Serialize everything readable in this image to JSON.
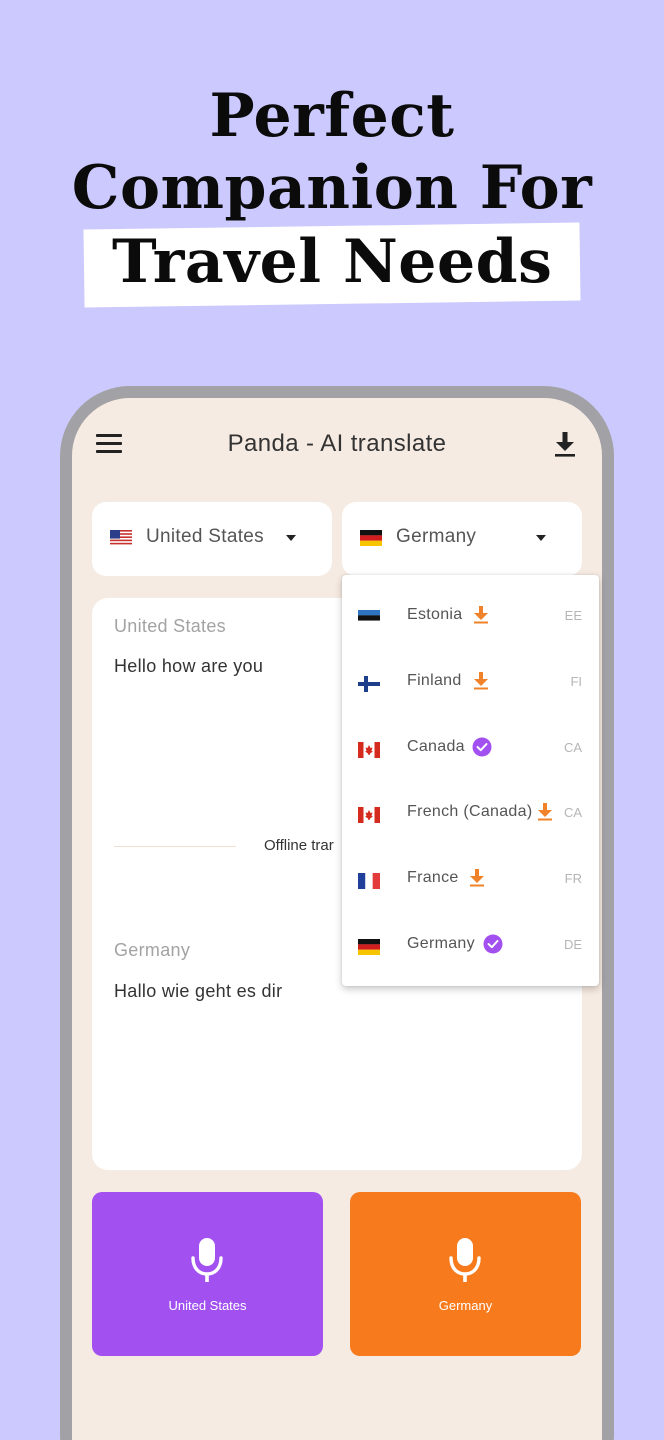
{
  "headline": {
    "line1": "Perfect",
    "line2": "Companion For",
    "line3": "Travel Needs"
  },
  "app": {
    "title": "Panda - AI translate",
    "menu_icon": "hamburger-menu-icon",
    "download_icon": "download-icon"
  },
  "selectors": {
    "source": {
      "label": "United States",
      "flag": "us"
    },
    "target": {
      "label": "Germany",
      "flag": "de"
    }
  },
  "translation": {
    "source_label": "United States",
    "source_text": "Hello how are you",
    "offline_text": "Offline trar",
    "target_label": "Germany",
    "target_text": "Hallo wie geht es dir"
  },
  "mic_buttons": {
    "left": {
      "label": "United States",
      "color": "#a251f0"
    },
    "right": {
      "label": "Germany",
      "color": "#f77b1c"
    }
  },
  "dropdown": {
    "items": [
      {
        "name": "Estonia",
        "code": "EE",
        "status": "download",
        "flag": "ee"
      },
      {
        "name": "Finland",
        "code": "FI",
        "status": "download",
        "flag": "fi"
      },
      {
        "name": "Canada",
        "code": "CA",
        "status": "downloaded",
        "flag": "ca"
      },
      {
        "name": "French (Canada)",
        "code": "CA",
        "status": "download",
        "flag": "ca"
      },
      {
        "name": "France",
        "code": "FR",
        "status": "download",
        "flag": "fr"
      },
      {
        "name": "Germany",
        "code": "DE",
        "status": "downloaded",
        "flag": "de"
      }
    ]
  },
  "colors": {
    "background": "#cbc9fd",
    "screen": "#f6ebe2",
    "accent_purple": "#a251f0",
    "accent_orange": "#f77b1c"
  }
}
